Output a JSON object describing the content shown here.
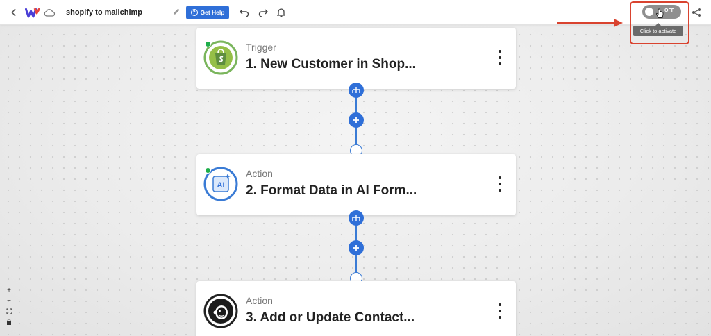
{
  "header": {
    "back_icon": "chevron-left-icon",
    "logo_icon": "app-logo-icon",
    "cloud_icon": "cloud-icon",
    "workflow_title": "shopify to mailchimp",
    "edit_icon": "pencil-icon",
    "get_help_label": "Get Help",
    "undo_icon": "undo-icon",
    "redo_icon": "redo-icon",
    "notifications_icon": "bell-icon",
    "share_icon": "share-icon"
  },
  "activation": {
    "toggle_label": "OFF",
    "toggle_state": "off",
    "tooltip": "Click to activate",
    "highlight_color": "#d9432f"
  },
  "steps": [
    {
      "type": "Trigger",
      "name": "1. New Customer in Shop...",
      "app_icon": "shopify-icon"
    },
    {
      "type": "Action",
      "name": "2. Format Data in AI Form...",
      "app_icon": "ai-formatter-icon"
    },
    {
      "type": "Action",
      "name": "3. Add or Update Contact...",
      "app_icon": "mailchimp-icon"
    }
  ],
  "canvas_controls": {
    "zoom_in": "+",
    "zoom_out": "−",
    "fit_icon": "fit-screen-icon",
    "lock_icon": "lock-icon"
  },
  "colors": {
    "accent": "#2f6fd8",
    "status_active": "#1fae4b",
    "toggle_off": "#8f8f8f"
  }
}
